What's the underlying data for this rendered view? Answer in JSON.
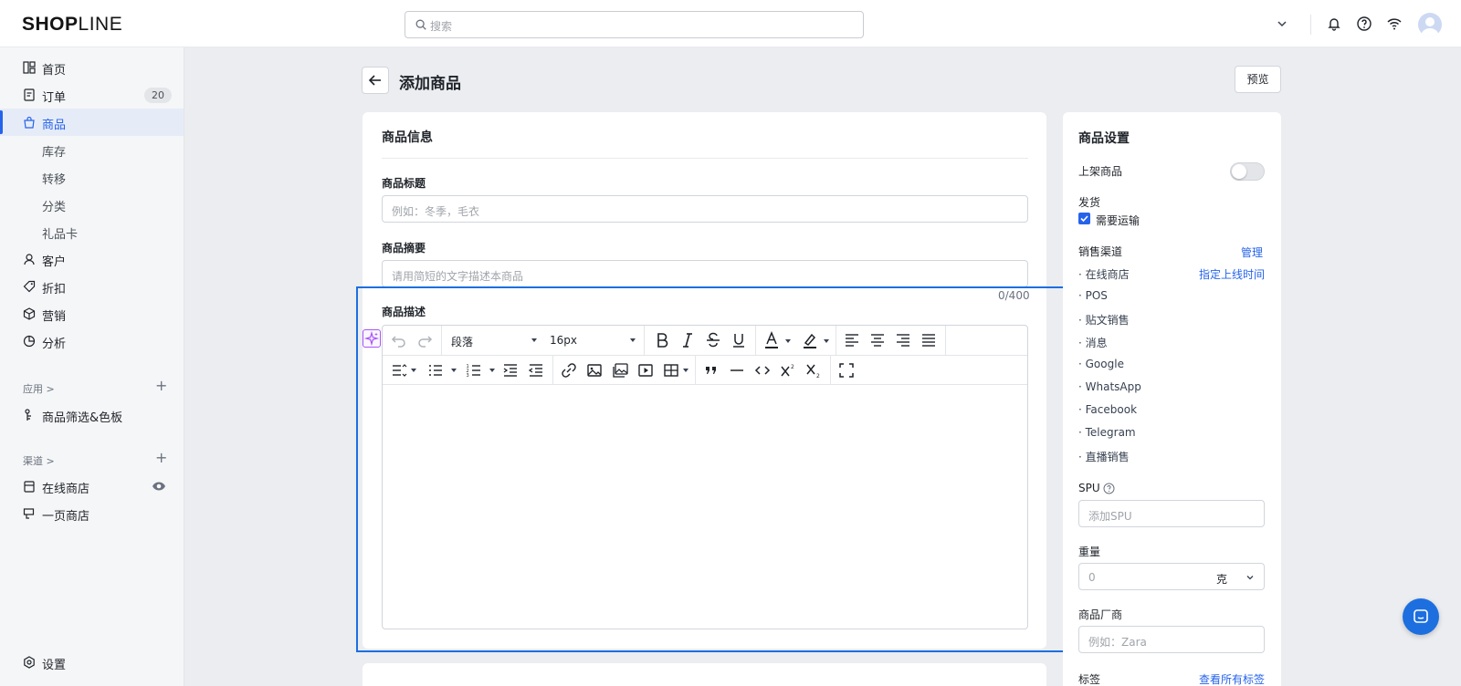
{
  "header": {
    "logo_text_bold": "SHOP",
    "logo_text_thin": "LINE",
    "search_placeholder": "搜索"
  },
  "sidebar": {
    "items": [
      {
        "label": "首页",
        "icon": "dashboard-icon"
      },
      {
        "label": "订单",
        "icon": "order-icon",
        "badge": "20"
      },
      {
        "label": "商品",
        "icon": "product-bag-icon",
        "active": true
      },
      {
        "label": "库存"
      },
      {
        "label": "转移"
      },
      {
        "label": "分类"
      },
      {
        "label": "礼品卡"
      },
      {
        "label": "客户",
        "icon": "customer-icon"
      },
      {
        "label": "折扣",
        "icon": "tag-icon"
      },
      {
        "label": "营销",
        "icon": "marketing-icon"
      },
      {
        "label": "分析",
        "icon": "analytics-icon"
      }
    ],
    "apps_section": "应用 >",
    "apps": [
      {
        "label": "商品筛选&色板"
      }
    ],
    "channels_section": "渠道 >",
    "channels": [
      {
        "label": "在线商店"
      },
      {
        "label": "一页商店"
      }
    ],
    "settings": "设置"
  },
  "page": {
    "title": "添加商品",
    "preview_button": "预览"
  },
  "product_info": {
    "card_title": "商品信息",
    "title_label": "商品标题",
    "title_placeholder": "例如：冬季，毛衣",
    "summary_label": "商品摘要",
    "summary_placeholder": "请用简短的文字描述本商品",
    "summary_counter": "0/400",
    "description_label": "商品描述",
    "editor": {
      "paragraph_select": "段落",
      "font_size_select": "16px"
    }
  },
  "settings_panel": {
    "title": "商品设置",
    "publish_label": "上架商品",
    "publish_on": false,
    "shipping_label": "发货",
    "requires_shipping_label": "需要运输",
    "requires_shipping_checked": true,
    "sales_channels_label": "销售渠道",
    "manage_link": "管理",
    "schedule_link": "指定上线时间",
    "channels": [
      "· 在线商店",
      "· POS",
      "· 贴文销售",
      "· 消息",
      "· Google",
      "· WhatsApp",
      "· Facebook",
      "· Telegram",
      "· 直播销售"
    ],
    "spu_label": "SPU",
    "spu_placeholder": "添加SPU",
    "weight_label": "重量",
    "weight_placeholder": "0",
    "weight_unit": "克",
    "vendor_label": "商品厂商",
    "vendor_placeholder": "例如：Zara",
    "tags_label": "标签",
    "view_all_tags_link": "查看所有标签"
  },
  "colors": {
    "accent": "#2563eb",
    "highlight_box": "#1d6fe0",
    "ai_button": "#a855f7"
  }
}
